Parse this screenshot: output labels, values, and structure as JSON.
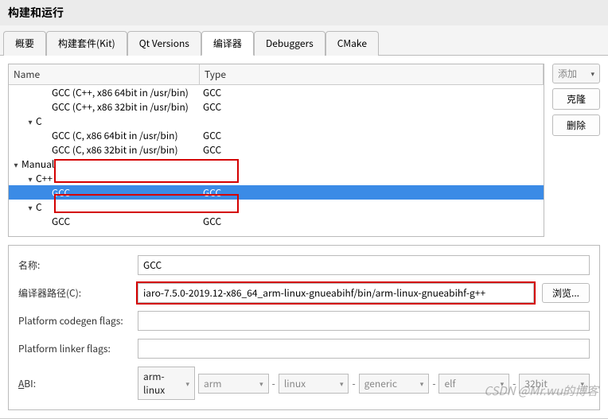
{
  "title": "构建和运行",
  "tabs": [
    "概要",
    "构建套件(Kit)",
    "Qt Versions",
    "编译器",
    "Debuggers",
    "CMake"
  ],
  "active_tab": "编译器",
  "side_buttons": {
    "add": "添加",
    "clone": "克隆",
    "remove": "删除"
  },
  "tree": {
    "headers": {
      "name": "Name",
      "type": "Type"
    },
    "rows": [
      {
        "depth": 3,
        "arrow": false,
        "name": "GCC (C++, x86 64bit in /usr/bin)",
        "type": "GCC"
      },
      {
        "depth": 3,
        "arrow": false,
        "name": "GCC (C++, x86 32bit in /usr/bin)",
        "type": "GCC"
      },
      {
        "depth": 2,
        "arrow": true,
        "name": "C",
        "type": ""
      },
      {
        "depth": 3,
        "arrow": false,
        "name": "GCC (C, x86 64bit in /usr/bin)",
        "type": "GCC"
      },
      {
        "depth": 3,
        "arrow": false,
        "name": "GCC (C, x86 32bit in /usr/bin)",
        "type": "GCC"
      },
      {
        "depth": 1,
        "arrow": true,
        "name": "Manual",
        "type": ""
      },
      {
        "depth": 2,
        "arrow": true,
        "name": "C++",
        "type": ""
      },
      {
        "depth": 3,
        "arrow": false,
        "name": "GCC",
        "type": "GCC",
        "selected": true
      },
      {
        "depth": 2,
        "arrow": true,
        "name": "C",
        "type": ""
      },
      {
        "depth": 3,
        "arrow": false,
        "name": "GCC",
        "type": "GCC"
      }
    ]
  },
  "form": {
    "name_label": "名称:",
    "name_value": "GCC",
    "path_label": "编译器路径(C):",
    "path_value": "iaro-7.5.0-2019.12-x86_64_arm-linux-gnueabihf/bin/arm-linux-gnueabihf-g++",
    "browse": "浏览...",
    "codegen_label": "Platform codegen flags:",
    "codegen_value": "",
    "linker_label": "Platform linker flags:",
    "linker_value": "",
    "abi_label": "ABI:",
    "abi": {
      "arch": "arm-linux",
      "sub": "arm",
      "os": "linux",
      "env": "generic",
      "fmt": "elf",
      "bits": "32bit"
    }
  },
  "watermark": "CSDN @Mr.wu的博客"
}
